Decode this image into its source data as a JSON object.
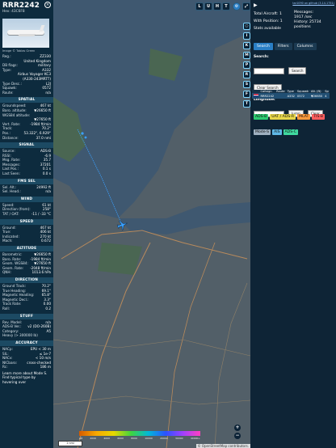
{
  "aircraft": {
    "callsign": "RRR2242",
    "hex_line": "Hex:  43C6F8",
    "photo_credit": "Image © Tobias Green",
    "info": [
      {
        "label": "Reg.:",
        "value": "ZZ330"
      },
      {
        "label": "",
        "value": "United Kingdom"
      },
      {
        "label": "DB flags:",
        "value": "military"
      },
      {
        "label": "Type:",
        "value": "A332"
      },
      {
        "label": "",
        "value": "Airbus Voyager KC3"
      },
      {
        "label": "",
        "value": "(A330-243MRTT)"
      },
      {
        "label": "Type Desc.:",
        "value": "L2J"
      },
      {
        "label": "Squawk:",
        "value": "0572"
      },
      {
        "label": "Route:",
        "value": "n/a"
      }
    ]
  },
  "sections": {
    "spatial": "SPATIAL",
    "signal": "SIGNAL",
    "fms": "FMS SEL",
    "wind": "WIND",
    "speed": "SPEED",
    "altitude": "ALTITUDE",
    "direction": "DIRECTION",
    "stuff": "STUFF",
    "accuracy": "ACCURACY"
  },
  "spatial": [
    {
      "label": "Groundspeed:",
      "value": "467 kt"
    },
    {
      "label": "Baro. altitude:",
      "value": "▼26650 ft"
    },
    {
      "label": "WGS84 altitude:",
      "value": ""
    },
    {
      "label": "",
      "value": "▼27650 ft"
    },
    {
      "label": "Vert. Rate:",
      "value": "-1984 ft/min"
    },
    {
      "label": "Track:",
      "value": "70.2°"
    },
    {
      "label": "Pos.:",
      "value": "53.322°, 6.929°"
    },
    {
      "label": "Distance:",
      "value": "37.0 nmi"
    }
  ],
  "signal": [
    {
      "label": "Source:",
      "value": "ADS-B"
    },
    {
      "label": "RSSI:",
      "value": "-6.9"
    },
    {
      "label": "Msg. Rate:",
      "value": "35.7"
    },
    {
      "label": "Messages:",
      "value": "37201"
    },
    {
      "label": "Last Pos.:",
      "value": "0.1 s"
    },
    {
      "label": "Last Seen:",
      "value": "0.0 s"
    }
  ],
  "fms": [
    {
      "label": "Sel. Alt.:",
      "value": "24992 ft"
    },
    {
      "label": "Sel. Head.:",
      "value": "n/a"
    }
  ],
  "wind": [
    {
      "label": "Speed:",
      "value": "61 kt"
    },
    {
      "label": "Direction (from):",
      "value": "258°"
    },
    {
      "label": "TAT / OAT:",
      "value": "-11 / -33 °C"
    }
  ],
  "speed": [
    {
      "label": "Ground:",
      "value": "467 kt"
    },
    {
      "label": "True:",
      "value": "406 kt"
    },
    {
      "label": "Indicated:",
      "value": "270 kt"
    },
    {
      "label": "Mach:",
      "value": "0.672"
    }
  ],
  "altitude": [
    {
      "label": "Barometric:",
      "value": "▼26650 ft"
    },
    {
      "label": "Baro. Rate:",
      "value": "-1984 ft/min"
    },
    {
      "label": "Geom. WGS84:",
      "value": "▼27650 ft"
    },
    {
      "label": "Geom. Rate:",
      "value": "-2048 ft/min"
    },
    {
      "label": "QNH:",
      "value": "1013.6 hPa"
    }
  ],
  "direction": [
    {
      "label": "Ground Track:",
      "value": "70.2°"
    },
    {
      "label": "True Heading:",
      "value": "69.1°"
    },
    {
      "label": "Magnetic Heading:",
      "value": "65.8°"
    },
    {
      "label": "Magnetic Decl.:",
      "value": "3.3°"
    },
    {
      "label": "Track Rate:",
      "value": "0.00"
    },
    {
      "label": "Roll:",
      "value": "0.2"
    }
  ],
  "stuff": [
    {
      "label": "Rev. Model:",
      "value": "n/a"
    },
    {
      "label": "ADS-B Ver.:",
      "value": "v2 (DO-260B)"
    },
    {
      "label": "Category:",
      "value": "A5"
    },
    {
      "label": "Heavy (> 300000 lb)",
      "value": ""
    }
  ],
  "accuracy": [
    {
      "label": "NACp:",
      "value": "EPU < 30 m"
    },
    {
      "label": "SIL:",
      "value": "≤ 1e-7"
    },
    {
      "label": "NACv:",
      "value": "< 10 m/s"
    },
    {
      "label": "NICbaro:",
      "value": "cross-checked"
    },
    {
      "label": "Rc:",
      "value": "186 m"
    }
  ],
  "footer_text": "Learn more about Mode S. Find typical type by hovering over",
  "map": {
    "top_buttons": [
      "L",
      "U",
      "H",
      "T"
    ],
    "side_buttons": [
      "○",
      "I",
      "K",
      "M",
      "P",
      "R",
      "S",
      "F",
      "T"
    ],
    "scale_label": "1 nmi",
    "legend_ticks": [
      "Alt",
      "2000",
      "4000",
      "6000",
      "8000",
      "10000",
      "20000",
      "30000",
      "40000+"
    ],
    "attribution": "© OpenStreetMap contributors.",
    "zoom_in": "+",
    "zoom_out": "−"
  },
  "right": {
    "link": "tar1090 on github (3.14.1751)",
    "stats": [
      {
        "label": "Total Aircraft:",
        "value": "1"
      },
      {
        "label": "With Position:",
        "value": "1"
      },
      {
        "label": "Stats available",
        "value": ""
      }
    ],
    "stats_right": [
      {
        "label": "Messages:",
        "value": "1917 /sec"
      },
      {
        "label": "History:",
        "value": "25734 positions"
      }
    ],
    "tabs": [
      "Search",
      "Filters",
      "Columns"
    ],
    "search_label": "Search:",
    "search_button": "Search",
    "clear_search": "Clear Search",
    "jump_label": "Jump to Airport or Latitude, Longitude:",
    "jump_button": "Jump",
    "clear_button": "Clear",
    "table": {
      "headers": [
        "",
        "Callsign",
        "Route",
        "Type",
        "Squawk",
        "Alt. (ft)",
        "Sp"
      ],
      "rows": [
        [
          "",
          "RRR2242",
          "",
          "A332",
          "0572",
          "▼26650",
          "4"
        ]
      ]
    },
    "chips": [
      {
        "label": "ADS-B",
        "color": "#2ecc71"
      },
      {
        "label": "UAT / ADS-R",
        "color": "#e8d64a"
      },
      {
        "label": "MLAT",
        "color": "#ff9a3c"
      },
      {
        "label": "TIS-B",
        "color": "#ff5e5e"
      },
      {
        "label": "Mode-S",
        "color": "#9fb0c0"
      },
      {
        "label": "AIS",
        "color": "#5fb8e6"
      },
      {
        "label": "ADS-C",
        "color": "#3fd9a0"
      }
    ]
  }
}
